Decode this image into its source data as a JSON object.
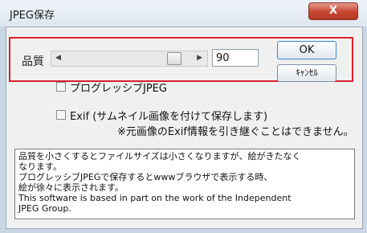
{
  "window": {
    "title": "JPEG保存",
    "close_label": "X"
  },
  "quality": {
    "label": "品質",
    "value": "90",
    "slider_value": 90,
    "slider_max": 100
  },
  "buttons": {
    "ok": "OK",
    "cancel": "ｷｬﾝｾﾙ"
  },
  "options": {
    "progressive": "プログレッシブJPEG",
    "exif": "Exif (サムネイル画像を付けて保存します)",
    "exif_note": "※元画像のExif情報を引き継ぐことはできません。"
  },
  "description": [
    "品質を小さくするとファイルサイズは小さくなりますが、絵がきたなく",
    "なります。",
    "プログレッシブJPEGで保存するとwwwブラウザで表示する時、",
    "絵が徐々に表示されます。",
    "This software is based in part on the work of the Independent",
    "JPEG Group."
  ],
  "colors": {
    "highlight": "#d8202a",
    "close_red": "#c6452f"
  }
}
